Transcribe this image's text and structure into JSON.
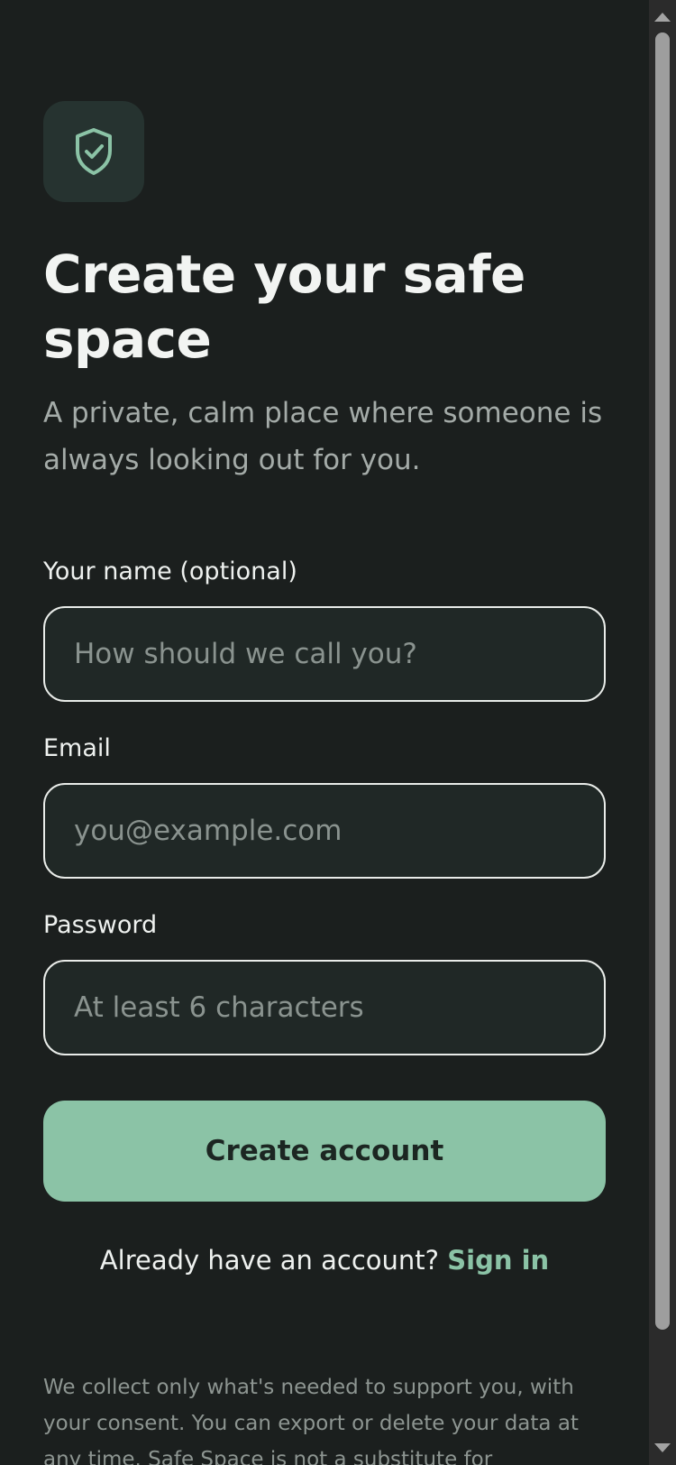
{
  "brand": {
    "logo_icon": "shield-check-icon",
    "accent_color": "#8bc3a6",
    "tile_color": "#263330"
  },
  "header": {
    "title": "Create your safe space",
    "subtitle": "A private, calm place where someone is always looking out for you."
  },
  "form": {
    "name": {
      "label": "Your name (optional)",
      "placeholder": "How should we call you?",
      "value": ""
    },
    "email": {
      "label": "Email",
      "placeholder": "you@example.com",
      "value": ""
    },
    "password": {
      "label": "Password",
      "placeholder": "At least 6 characters",
      "value": ""
    },
    "submit_label": "Create account"
  },
  "signin": {
    "prompt": "Already have an account?",
    "link_label": "Sign in"
  },
  "footer": {
    "note": "We collect only what's needed to support you, with your consent. You can export or delete your data at any time. Safe Space is not a substitute for professional"
  }
}
